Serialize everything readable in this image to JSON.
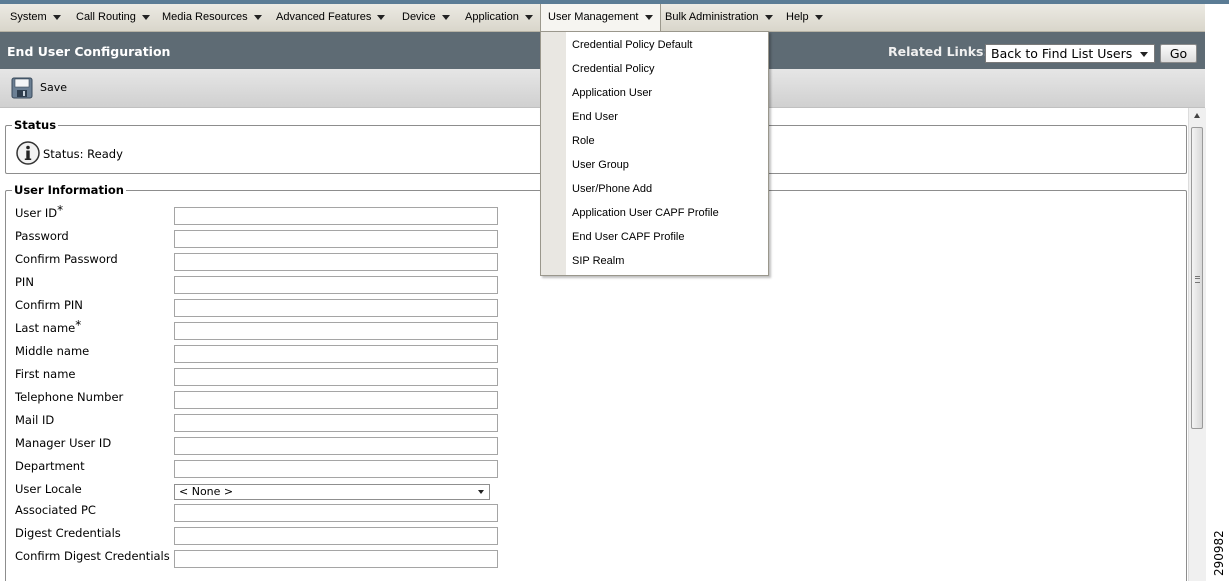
{
  "menubar": {
    "items": [
      {
        "label": "System"
      },
      {
        "label": "Call Routing"
      },
      {
        "label": "Media Resources"
      },
      {
        "label": "Advanced Features"
      },
      {
        "label": "Device"
      },
      {
        "label": "Application"
      },
      {
        "label": "User Management",
        "active": true
      },
      {
        "label": "Bulk Administration"
      },
      {
        "label": "Help"
      }
    ]
  },
  "user_management_menu": {
    "items": [
      {
        "label": "Credential Policy Default"
      },
      {
        "label": "Credential Policy"
      },
      {
        "label": "Application User"
      },
      {
        "label": "End User"
      },
      {
        "label": "Role"
      },
      {
        "label": "User Group"
      },
      {
        "label": "User/Phone Add"
      },
      {
        "label": "Application User CAPF Profile"
      },
      {
        "label": "End User CAPF Profile"
      },
      {
        "label": "SIP Realm"
      }
    ]
  },
  "header": {
    "title": "End User Configuration",
    "related_links_label": "Related Links:",
    "related_links_value": "Back to Find List Users",
    "go_label": "Go"
  },
  "toolbar": {
    "save_label": "Save",
    "save_icon": "floppy-disk-icon"
  },
  "status": {
    "legend": "Status",
    "text": "Status: Ready",
    "icon": "info-icon"
  },
  "user_info": {
    "legend": "User Information",
    "fields": [
      {
        "label": "User ID",
        "required": "*",
        "value": ""
      },
      {
        "label": "Password",
        "value": ""
      },
      {
        "label": "Confirm Password",
        "value": ""
      },
      {
        "label": "PIN",
        "value": ""
      },
      {
        "label": "Confirm PIN",
        "value": ""
      },
      {
        "label": "Last name",
        "required": "*",
        "value": ""
      },
      {
        "label": "Middle name",
        "value": ""
      },
      {
        "label": "First name",
        "value": ""
      },
      {
        "label": "Telephone Number",
        "value": ""
      },
      {
        "label": "Mail ID",
        "value": ""
      },
      {
        "label": "Manager User ID",
        "value": ""
      },
      {
        "label": "Department",
        "value": ""
      },
      {
        "label": "User Locale",
        "value": "< None >"
      },
      {
        "label": "Associated PC",
        "value": ""
      },
      {
        "label": "Digest Credentials",
        "value": ""
      },
      {
        "label": "Confirm Digest Credentials",
        "value": ""
      }
    ]
  },
  "figure_number": "290982",
  "colors": {
    "title_bar": "#5e6b74",
    "menubar": "#d9d6cb",
    "accent_strip": "#5b7c95"
  }
}
